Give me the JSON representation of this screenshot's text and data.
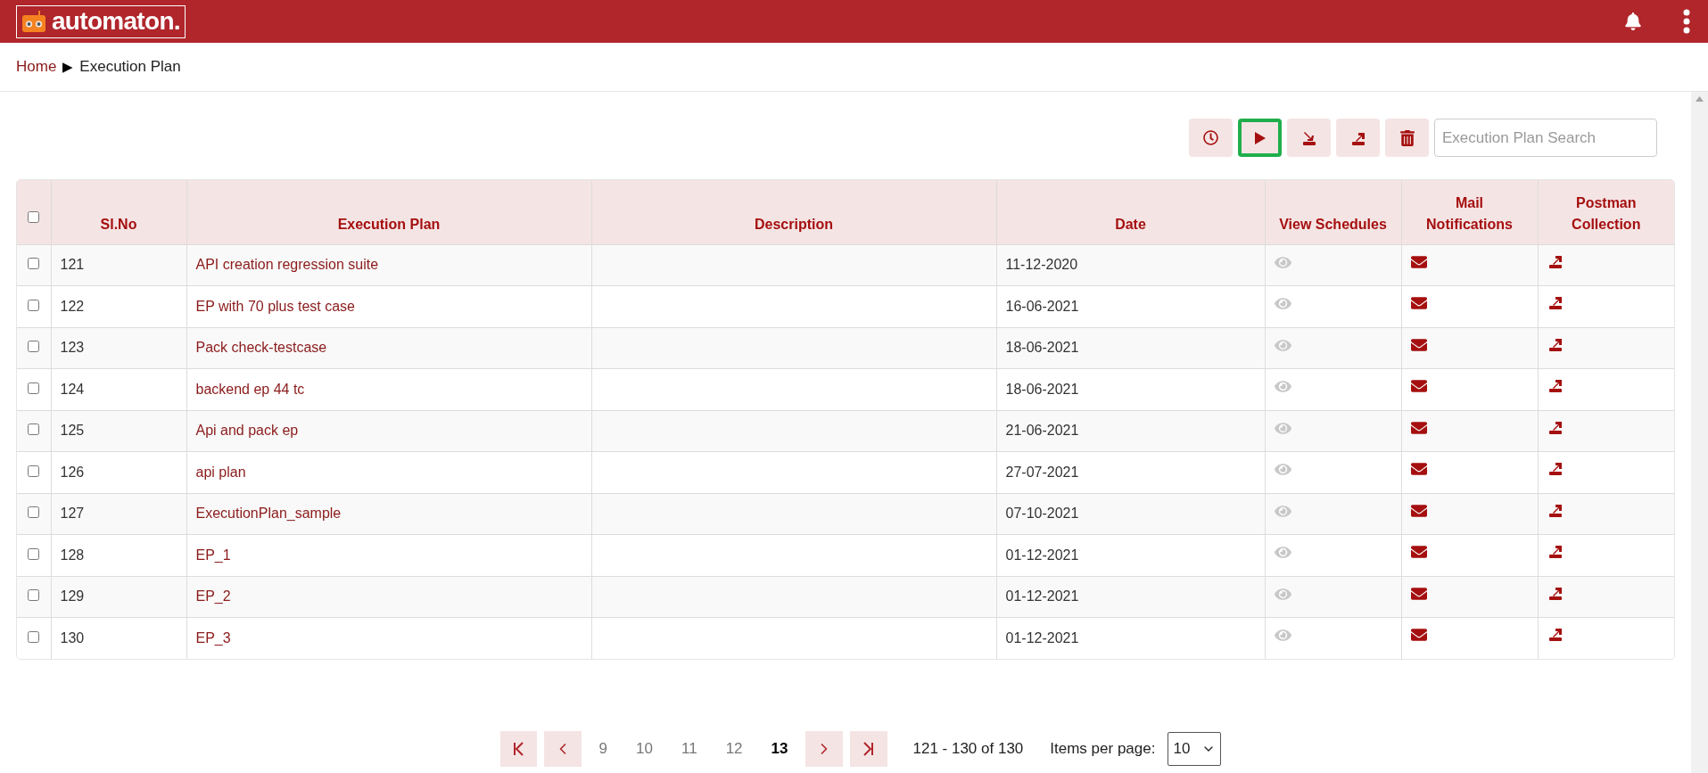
{
  "header": {
    "logo": "automaton."
  },
  "breadcrumb": {
    "home": "Home",
    "separator": "▶",
    "current": "Execution Plan"
  },
  "toolbar": {
    "buttons": [
      {
        "kind": "schedule",
        "focused": false
      },
      {
        "kind": "run",
        "focused": true
      },
      {
        "kind": "import",
        "focused": false
      },
      {
        "kind": "export",
        "focused": false
      },
      {
        "kind": "delete",
        "focused": false
      }
    ],
    "search": {
      "placeholder": "Execution Plan Search"
    }
  },
  "table": {
    "select_all": {
      "checked": false
    },
    "columns": [
      "Sl.No",
      "Execution Plan",
      "Description",
      "Date",
      "View Schedules",
      "Mail Notifications",
      "Postman Collection"
    ],
    "rows": [
      {
        "checked": false,
        "sl_no": "121",
        "plan": "API creation regression suite",
        "date": "11-12-2020"
      },
      {
        "checked": false,
        "sl_no": "122",
        "plan": "EP with 70 plus test case",
        "date": "16-06-2021"
      },
      {
        "checked": false,
        "sl_no": "123",
        "plan": "Pack check-testcase",
        "date": "18-06-2021"
      },
      {
        "checked": false,
        "sl_no": "124",
        "plan": "backend ep 44 tc",
        "date": "18-06-2021"
      },
      {
        "checked": false,
        "sl_no": "125",
        "plan": "Api and pack ep",
        "date": "21-06-2021"
      },
      {
        "checked": false,
        "sl_no": "126",
        "plan": "api plan",
        "date": "27-07-2021"
      },
      {
        "checked": false,
        "sl_no": "127",
        "plan": "ExecutionPlan_sample",
        "date": "07-10-2021"
      },
      {
        "checked": false,
        "sl_no": "128",
        "plan": "EP_1",
        "date": "01-12-2021"
      },
      {
        "checked": false,
        "sl_no": "129",
        "plan": "EP_2",
        "date": "01-12-2021"
      },
      {
        "checked": false,
        "sl_no": "130",
        "plan": "EP_3",
        "date": "01-12-2021"
      }
    ]
  },
  "pagination": {
    "pages": [
      {
        "label": "9",
        "selected": false
      },
      {
        "label": "10",
        "selected": false
      },
      {
        "label": "11",
        "selected": false
      },
      {
        "label": "12",
        "selected": false
      },
      {
        "label": "13",
        "selected": true
      }
    ],
    "range": "121 - 130 of 130",
    "items_per_page_label": "Items per page:",
    "items_per_page": "10"
  }
}
